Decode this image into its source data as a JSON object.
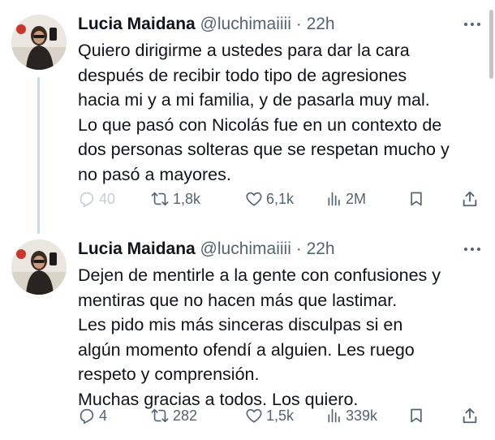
{
  "colors": {
    "text": "#0f1419",
    "muted": "#536471",
    "thread_line": "#cfd9de"
  },
  "tweets": [
    {
      "author_name": "Lucia Maidana",
      "handle": "@luchimaiiii",
      "separator": "·",
      "time": "22h",
      "text_lines": [
        "Quiero dirigirme a ustedes para dar la cara",
        "después de recibir todo tipo de agresiones",
        "hacia mi y a mi familia, y de pasarla muy mal.",
        "Lo que pasó con Nicolás fue en un contexto de",
        "dos personas solteras que se respetan mucho y",
        "no pasó a mayores."
      ],
      "replies": "40",
      "retweets": "1,8k",
      "likes": "6,1k",
      "views": "2M"
    },
    {
      "author_name": "Lucia Maidana",
      "handle": "@luchimaiiii",
      "separator": "·",
      "time": "22h",
      "text_lines": [
        "Dejen de mentirle a la gente con confusiones y",
        "mentiras que no hacen más que lastimar.",
        "Les pido mis más sinceras disculpas si en",
        "algún momento ofendí a alguien. Les ruego",
        "respeto y comprensión.",
        "Muchas gracias a todos. Los quiero."
      ],
      "replies": "4",
      "retweets": "282",
      "likes": "1,5k",
      "views": "339k"
    }
  ],
  "icons": {
    "more": "more-horizontal-icon",
    "reply": "reply-icon",
    "retweet": "retweet-icon",
    "like": "heart-icon",
    "views": "views-chart-icon",
    "bookmark": "bookmark-icon",
    "share": "share-icon"
  }
}
